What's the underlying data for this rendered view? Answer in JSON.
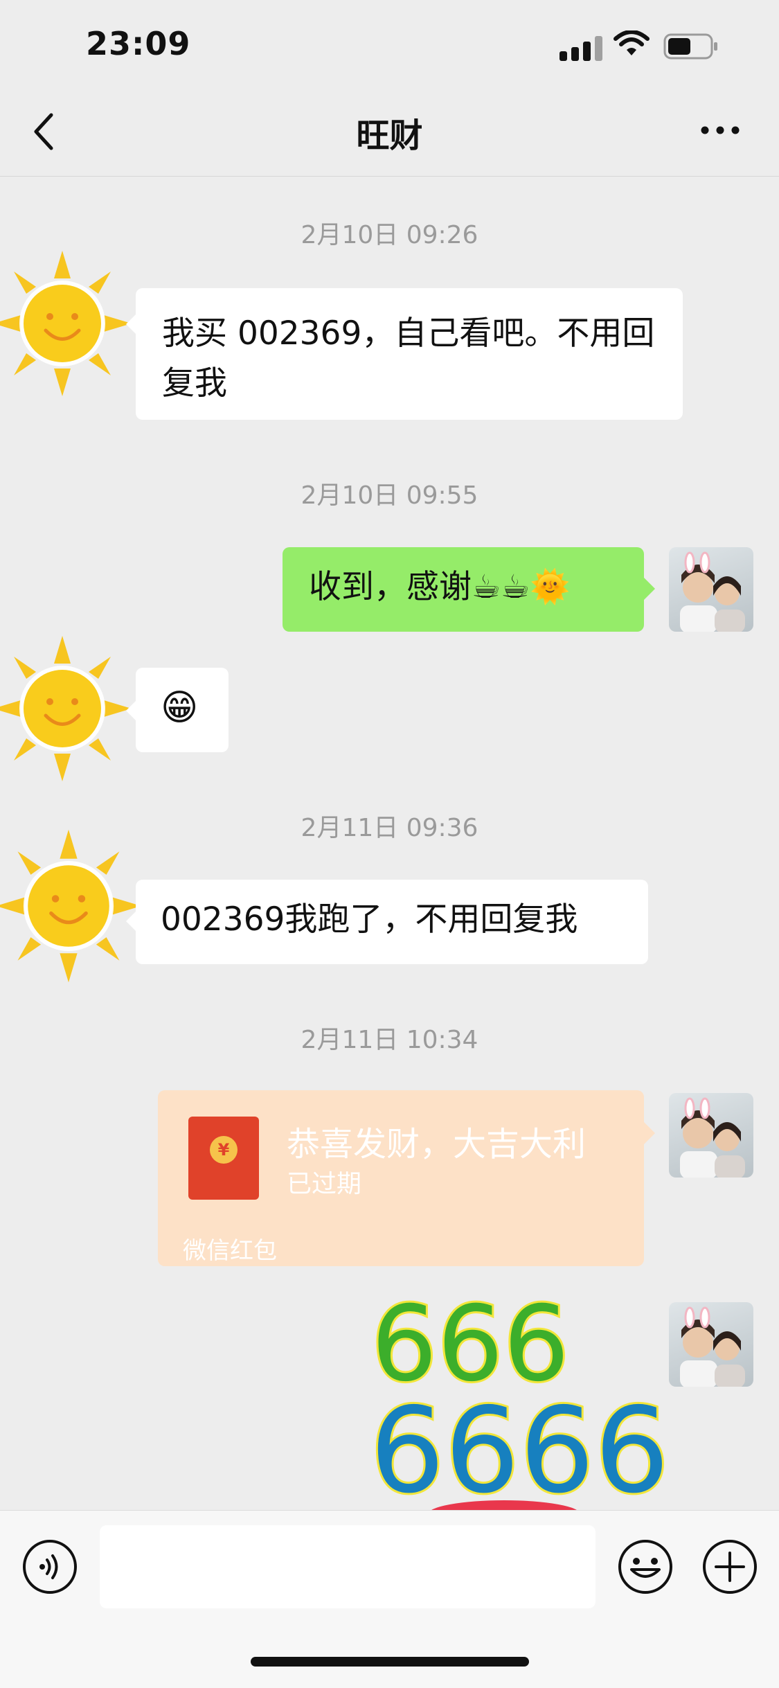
{
  "status_bar": {
    "time": "23:09"
  },
  "nav": {
    "title": "旺财"
  },
  "messages": [
    {
      "timestamp": "2月10日 09:26",
      "text": "我买 002369，自己看吧。不用回复我"
    },
    {
      "timestamp": "2月10日 09:55",
      "text": "收到，感谢☕☕🌞"
    },
    {
      "text": "😁"
    },
    {
      "timestamp": "2月11日 09:36",
      "text": "002369我跑了，不用回复我"
    },
    {
      "timestamp": "2月11日 10:34",
      "red_packet": {
        "title": "恭喜发财，大吉大利",
        "status": "已过期",
        "brand": "微信红包",
        "coin": "¥"
      }
    },
    {
      "sticker_lines": [
        "666",
        "6666"
      ]
    }
  ]
}
